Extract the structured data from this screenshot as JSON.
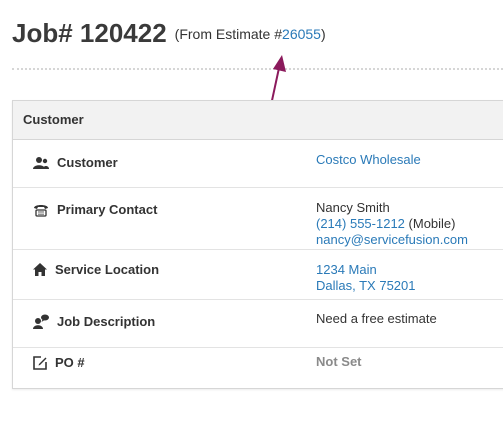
{
  "header": {
    "job_label": "Job# 120422",
    "source_prefix": "(From Estimate #",
    "estimate_number": "26055",
    "source_suffix": ")"
  },
  "panel": {
    "title": "Customer",
    "rows": {
      "customer": {
        "label": "Customer",
        "icon": "users-icon",
        "value": "Costco Wholesale"
      },
      "primary_contact": {
        "label": "Primary Contact",
        "icon": "phone-icon",
        "name": "Nancy Smith",
        "phone": "(214) 555-1212",
        "phone_type": "(Mobile)",
        "email": "nancy@servicefusion.com"
      },
      "service_location": {
        "label": "Service Location",
        "icon": "home-icon",
        "address_line1": "1234 Main",
        "address_line2": "Dallas, TX 75201"
      },
      "job_description": {
        "label": "Job Description",
        "icon": "user-comment-icon",
        "value": "Need a free estimate"
      },
      "po": {
        "label": "PO #",
        "icon": "edit-icon",
        "value": "Not Set"
      }
    }
  },
  "colors": {
    "link": "#2a7ab8",
    "annotation_arrow": "#8b1a5c"
  }
}
